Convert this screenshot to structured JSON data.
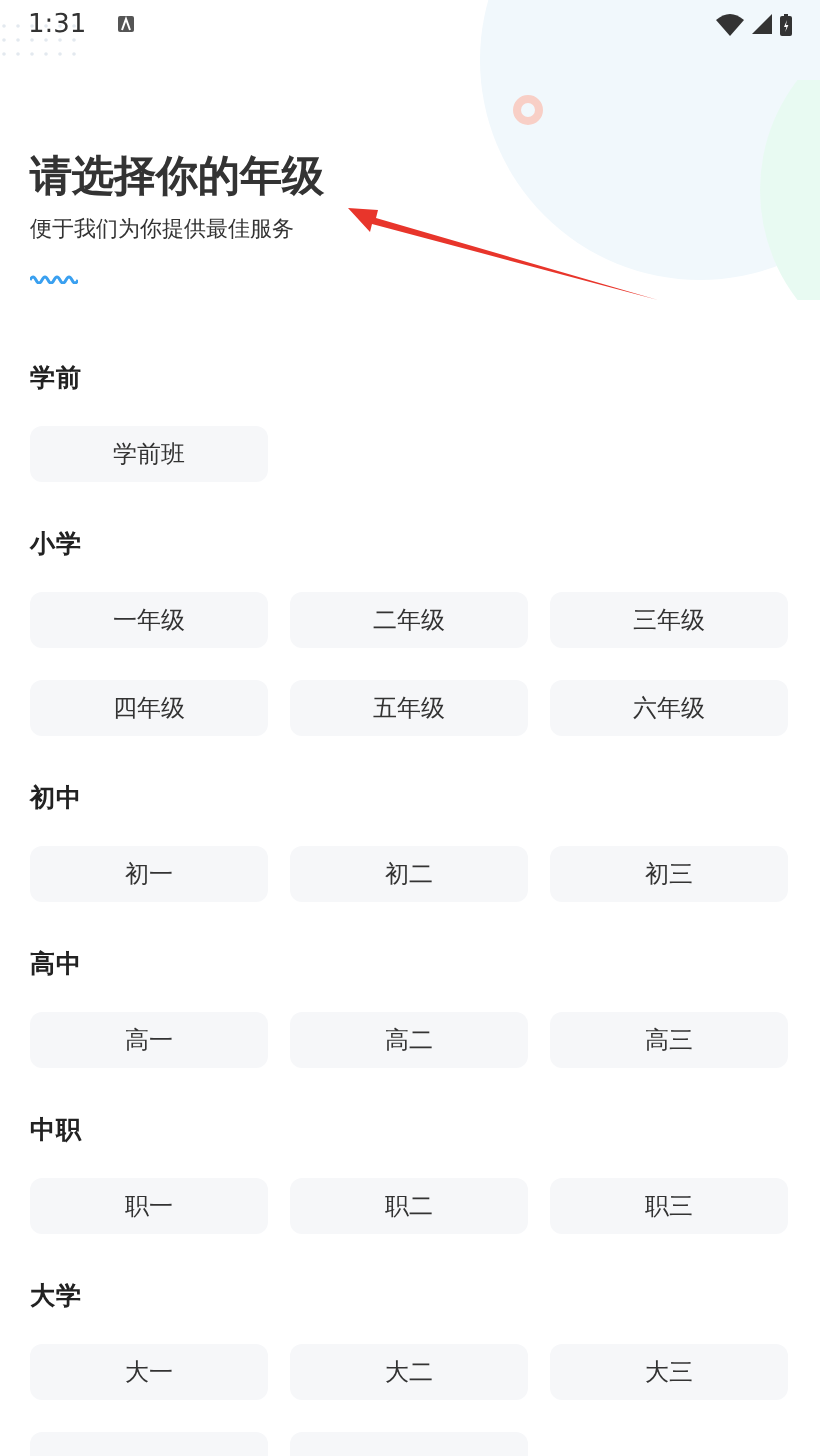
{
  "status_bar": {
    "time": "1:31"
  },
  "header": {
    "title": "请选择你的年级",
    "subtitle": "便于我们为你提供最佳服务"
  },
  "sections": [
    {
      "title": "学前",
      "options": [
        {
          "kind": "option",
          "label": "学前班"
        }
      ]
    },
    {
      "title": "小学",
      "options": [
        {
          "kind": "option",
          "label": "一年级"
        },
        {
          "kind": "option",
          "label": "二年级"
        },
        {
          "kind": "option",
          "label": "三年级"
        },
        {
          "kind": "option",
          "label": "四年级"
        },
        {
          "kind": "option",
          "label": "五年级"
        },
        {
          "kind": "option",
          "label": "六年级"
        }
      ]
    },
    {
      "title": "初中",
      "options": [
        {
          "kind": "option",
          "label": "初一"
        },
        {
          "kind": "option",
          "label": "初二"
        },
        {
          "kind": "option",
          "label": "初三"
        }
      ]
    },
    {
      "title": "高中",
      "options": [
        {
          "kind": "option",
          "label": "高一"
        },
        {
          "kind": "option",
          "label": "高二"
        },
        {
          "kind": "option",
          "label": "高三"
        }
      ]
    },
    {
      "title": "中职",
      "options": [
        {
          "kind": "option",
          "label": "职一"
        },
        {
          "kind": "option",
          "label": "职二"
        },
        {
          "kind": "option",
          "label": "职三"
        }
      ]
    },
    {
      "title": "大学",
      "options": [
        {
          "kind": "option",
          "label": "大一"
        },
        {
          "kind": "option",
          "label": "大二"
        },
        {
          "kind": "option",
          "label": "大三"
        },
        {
          "kind": "cut"
        },
        {
          "kind": "cut"
        }
      ]
    }
  ]
}
